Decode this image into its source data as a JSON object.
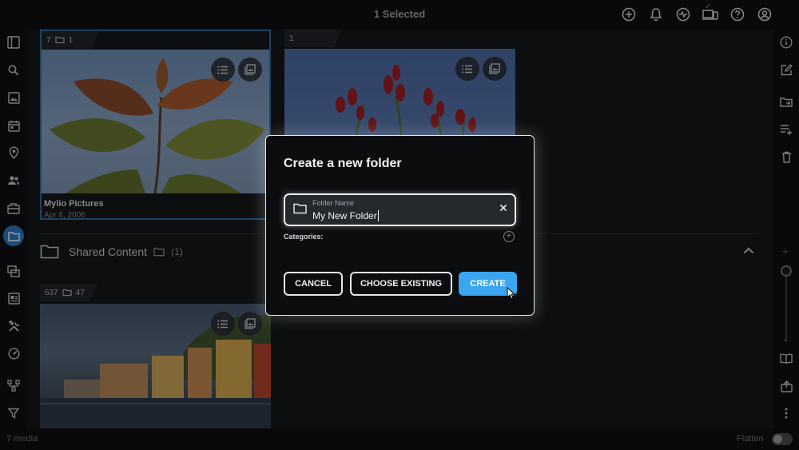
{
  "header": {
    "title": "1 Selected",
    "icons": [
      "add-circle-icon",
      "bell-icon",
      "activity-icon",
      "devices-icon",
      "help-icon",
      "account-icon"
    ]
  },
  "left_sidebar": {
    "icons": [
      "sidebar-toggle-icon",
      "search-icon",
      "photos-icon",
      "calendar-icon",
      "map-pin-icon",
      "people-icon",
      "sources-icon",
      "folder-icon",
      "albums-icon",
      "collections-icon",
      "tools-icon",
      "dashboard-icon",
      "graph-icon",
      "filter-icon"
    ],
    "active": "folder-icon"
  },
  "right_sidebar": {
    "icons": [
      "info-icon",
      "edit-icon",
      "move-folder-icon",
      "add-to-list-icon",
      "trash-icon",
      "book-icon",
      "export-icon",
      "more-icon"
    ]
  },
  "zoom": {
    "plus": "+",
    "minus": "-"
  },
  "cards": [
    {
      "count": "7",
      "folders": "1",
      "name": "Mylio Pictures",
      "date": "Apr 8, 2006"
    },
    {
      "count": "1"
    },
    {
      "count": "637",
      "folders": "47"
    }
  ],
  "shared_section": {
    "title": "Shared Content",
    "count": "(1)"
  },
  "footer": {
    "media_count": "7 media",
    "flatten_label": "Flatten"
  },
  "dialog": {
    "title": "Create a new folder",
    "field_label": "Folder Name",
    "field_value": "My New Folder",
    "categories_label": "Categories:",
    "cancel_label": "CANCEL",
    "choose_label": "CHOOSE EXISTING",
    "create_label": "CREATE"
  },
  "colors": {
    "accent": "#3aa5f0",
    "selection": "#2f7bc2",
    "background": "#15171a"
  }
}
